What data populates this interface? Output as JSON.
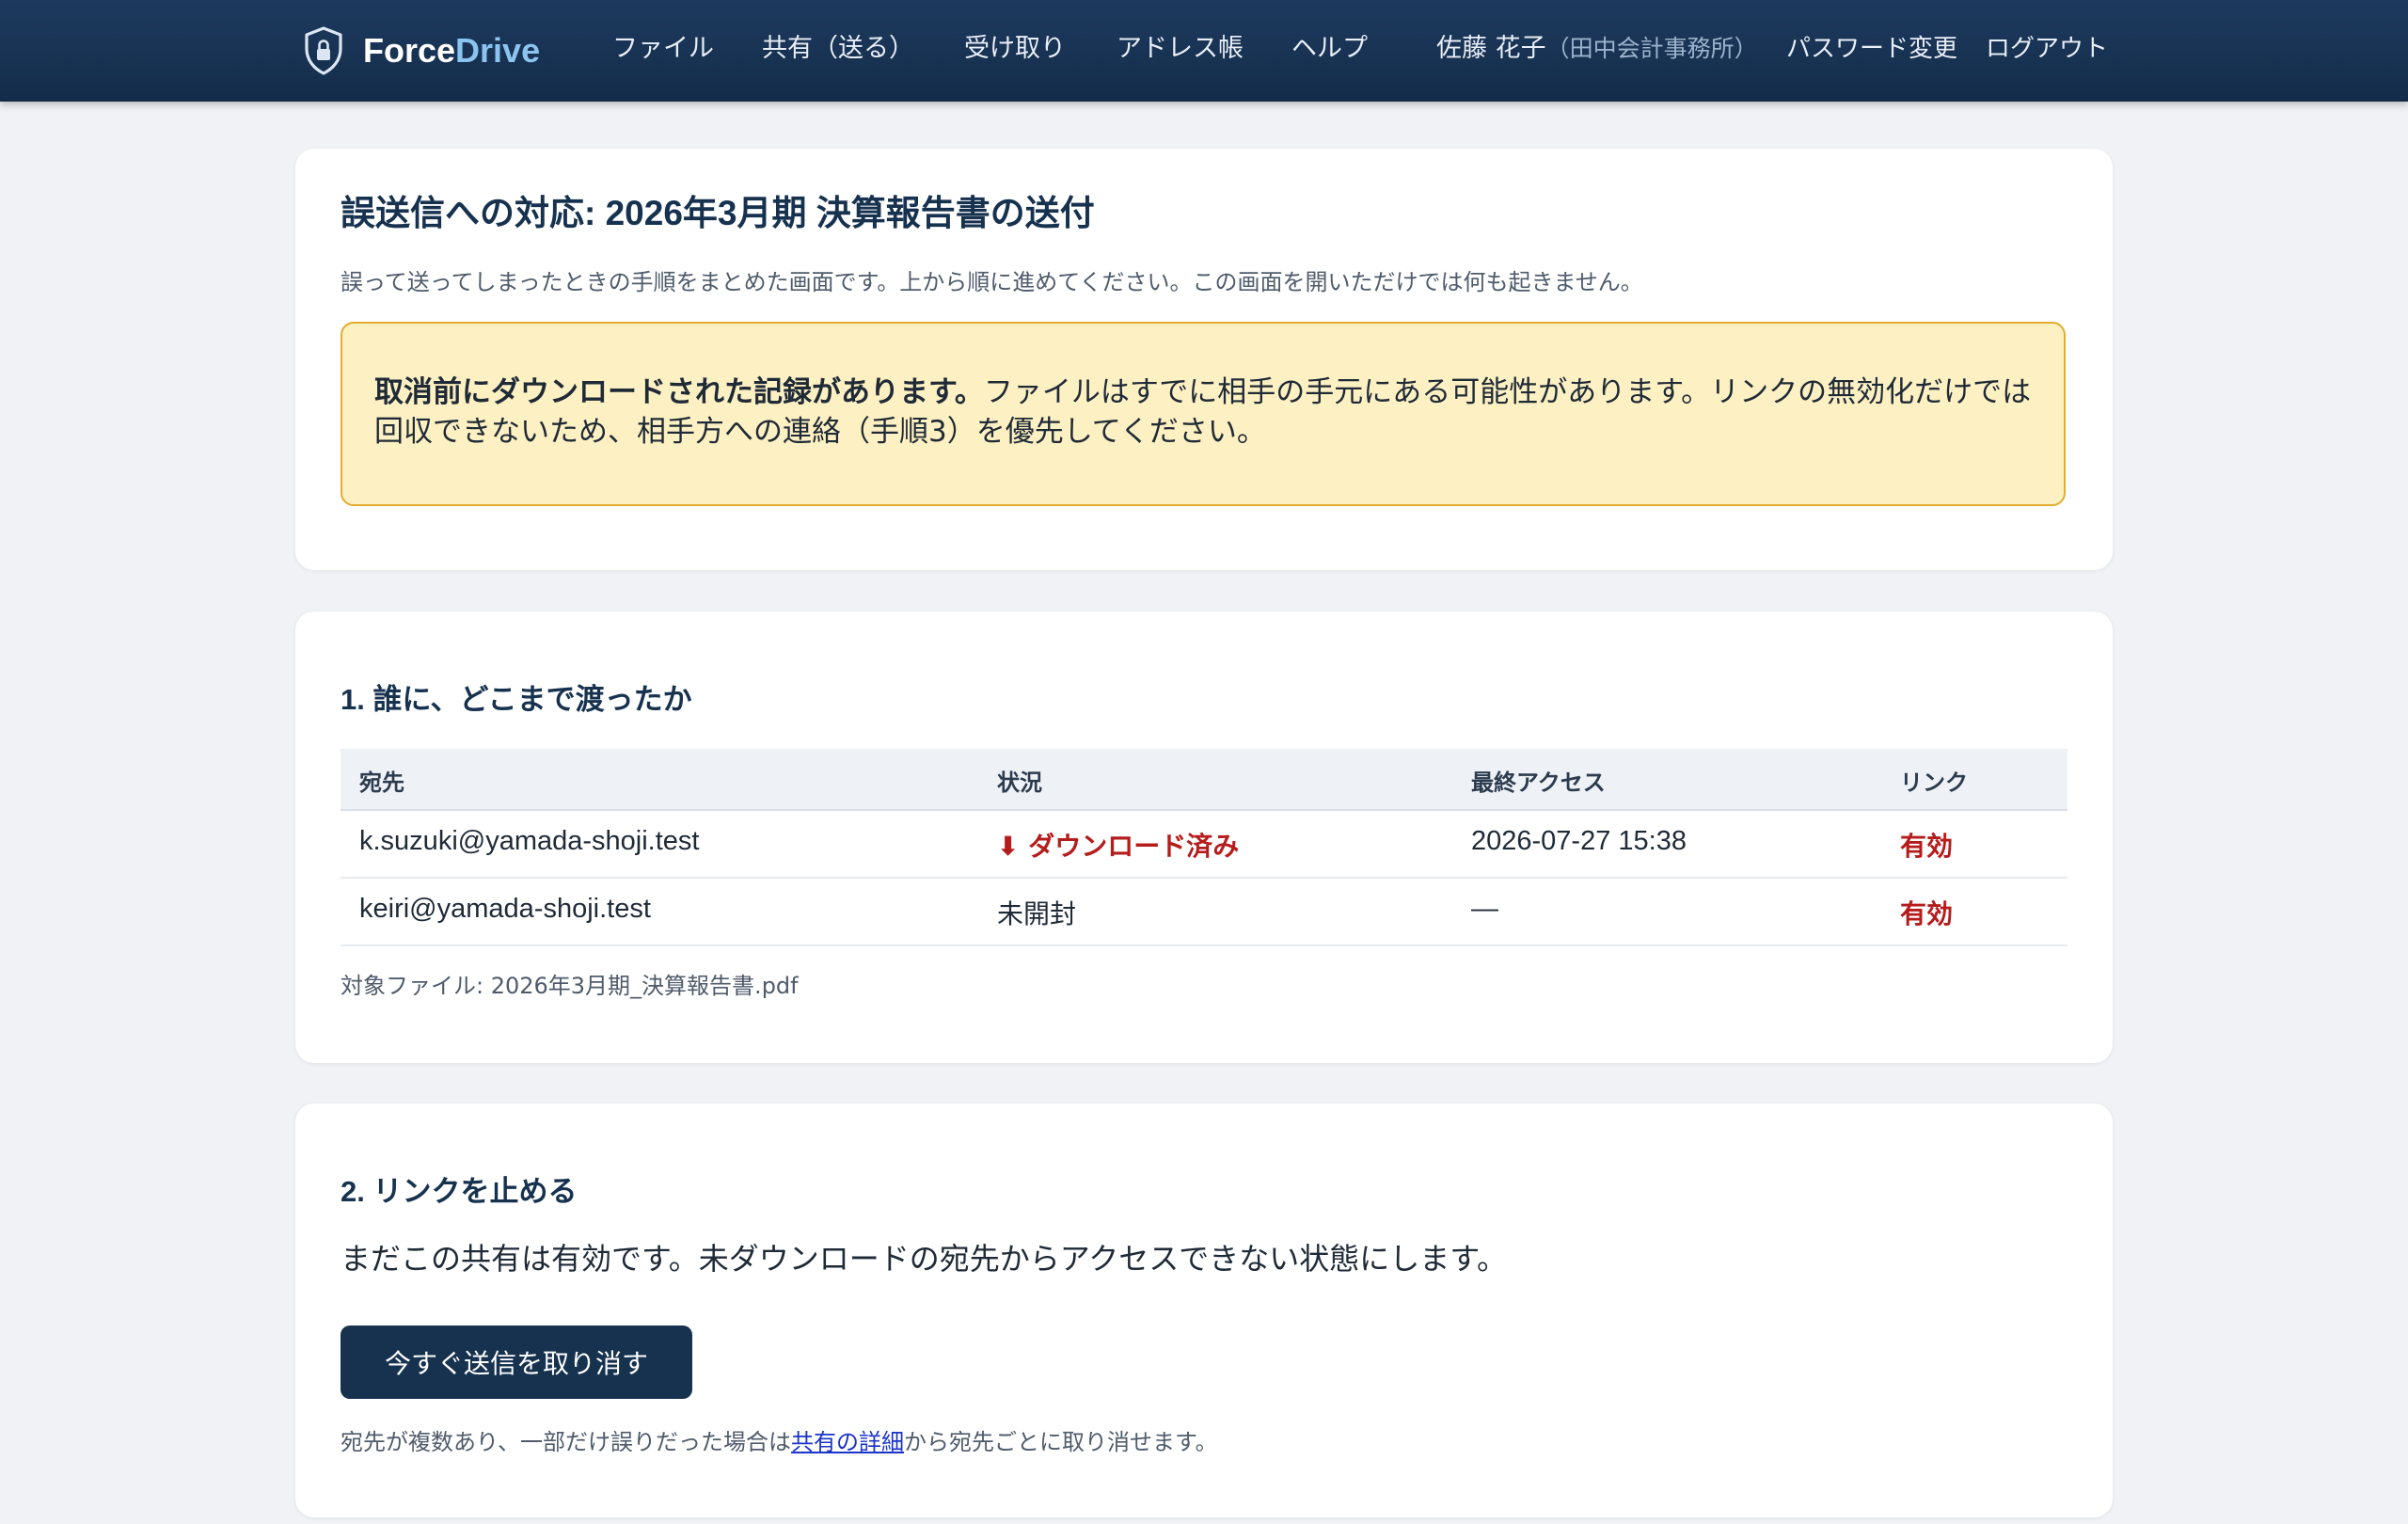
{
  "header": {
    "brand": {
      "part1": "Force",
      "part2": "Drive",
      "accent_color": "#8cc4f0"
    },
    "nav": [
      {
        "label": "ファイル"
      },
      {
        "label": "共有（送る）"
      },
      {
        "label": "受け取り"
      },
      {
        "label": "アドレス帳"
      },
      {
        "label": "ヘルプ"
      }
    ],
    "user": {
      "name": "佐藤 花子",
      "org": "（田中会計事務所）"
    },
    "password_change": "パスワード変更",
    "logout": "ログアウト",
    "background_color": "#17324f"
  },
  "page": {
    "title": "誤送信への対応: 2026年3月期 決算報告書の送付",
    "intro": "誤って送ってしまったときの手順をまとめた画面です。上から順に進めてください。この画面を開いただけでは何も起きません。",
    "warning": {
      "bold": "取消前にダウンロードされた記録があります。",
      "text": "ファイルはすでに相手の手元にある可能性があります。リンクの無効化だけでは回収できないため、相手方への連絡（手順3）を優先してください。",
      "background_color": "#fdf0c2",
      "border_color": "#e3ac2f"
    }
  },
  "step1": {
    "heading": "1. 誰に、どこまで渡ったか",
    "columns": [
      "宛先",
      "状況",
      "最終アクセス",
      "リンク"
    ],
    "rows": [
      {
        "recipient": "k.suzuki@yamada-shoji.test",
        "status": "ダウンロード済み",
        "status_icon": "download-arrow-icon",
        "last_access": "2026-07-27 15:38",
        "link": "有効"
      },
      {
        "recipient": "keiri@yamada-shoji.test",
        "status": "未開封",
        "last_access": "—",
        "link": "有効"
      }
    ],
    "file_note": "対象ファイル: 2026年3月期_決算報告書.pdf",
    "alert_color": "#b51c1c"
  },
  "step2": {
    "heading": "2. リンクを止める",
    "description": "まだこの共有は有効です。未ダウンロードの宛先からアクセスできない状態にします。",
    "button_label": "今すぐ送信を取り消す",
    "note_before": "宛先が複数あり、一部だけ誤りだった場合は",
    "note_link": "共有の詳細",
    "note_after": "から宛先ごとに取り消せます。"
  }
}
